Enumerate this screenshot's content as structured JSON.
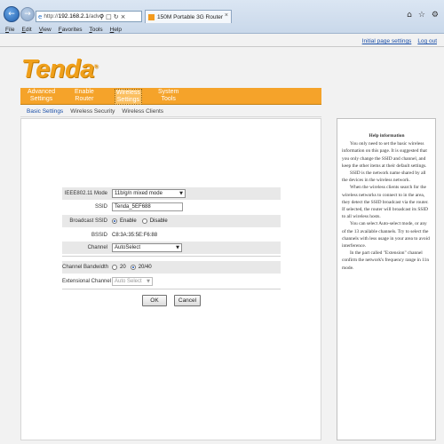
{
  "browser": {
    "url_host": "192.168.2.1",
    "url_prefix": "http://",
    "url_suffix": "/advd",
    "tab_title": "150M Portable 3G Router",
    "menu": [
      {
        "key": "F",
        "rest": "ile"
      },
      {
        "key": "E",
        "rest": "dit"
      },
      {
        "key": "V",
        "rest": "iew"
      },
      {
        "key": "F",
        "rest": "avorites"
      },
      {
        "key": "T",
        "rest": "ools"
      },
      {
        "key": "H",
        "rest": "elp"
      }
    ]
  },
  "top_links": {
    "wizard": "Initial page settings",
    "logout": "Log out"
  },
  "logo": {
    "text": "Tenda",
    "mark": "®"
  },
  "main_nav": [
    {
      "line1": "Advanced",
      "line2": "Settings"
    },
    {
      "line1": "Enable",
      "line2": "Router"
    },
    {
      "line1": "Wireless",
      "line2": "Settings"
    },
    {
      "line1": "System",
      "line2": "Tools"
    }
  ],
  "sub_nav": [
    "Basic Settings",
    "Wireless Security",
    "Wireless Clients"
  ],
  "form": {
    "mode": {
      "label": "IEEE802.11 Mode",
      "value": "11b/g/n mixed mode"
    },
    "ssid": {
      "label": "SSID",
      "value": "Tenda_5EF688"
    },
    "broadcast": {
      "label": "Broadcast SSID",
      "enable": "Enable",
      "disable": "Disable",
      "selected": "Enable"
    },
    "bssid": {
      "label": "BSSID",
      "value": "C8:3A:35:5E:F6:88"
    },
    "channel": {
      "label": "Channel",
      "value": "AutoSelect"
    },
    "bandwidth": {
      "label": "Channel Bandwidth",
      "opt1": "20",
      "opt2": "20/40",
      "selected": "20/40"
    },
    "ext_channel": {
      "label": "Extensional Channel",
      "value": "Auto Select"
    }
  },
  "buttons": {
    "ok": "OK",
    "cancel": "Cancel"
  },
  "help": {
    "title": "Help information",
    "paragraphs": [
      "You only need to set the basic wireless information on this page. It is suggested that you only change the SSID and channel, and keep the other items at their default settings.",
      "SSID is the network name shared by all the devices in the wireless network.",
      "When the wireless clients search for the wireless networks to connect to in the area, they detect the SSID broadcast via the router. If selected, the router will broadcast its SSID to all wireless hosts.",
      "You can select Auto-select mode, or any of the 13 available channels. Try to select the channels with less usage in your area to avoid interference.",
      "In the part called \"Extension\" channel confirm the network's frequency range in 11n mode."
    ]
  },
  "colors": {
    "accent": "#f5a32a",
    "link": "#1b4fa8",
    "logo": "#f0a01b"
  }
}
